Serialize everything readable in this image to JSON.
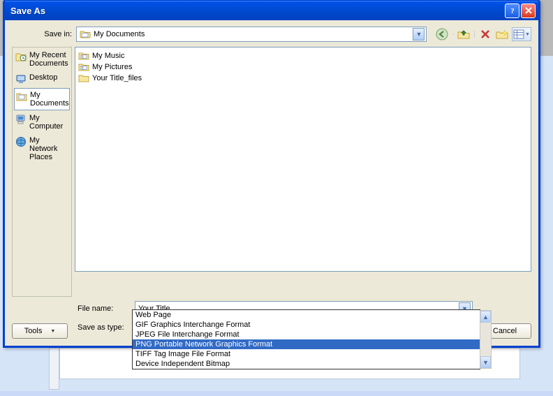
{
  "dialog": {
    "title": "Save As",
    "savein_label": "Save in:",
    "savein_value": "My Documents",
    "filename_label": "File name:",
    "filename_value": "Your Title",
    "savetype_label": "Save as type:",
    "savetype_value": "PNG Portable Network Graphics Format",
    "tools_label": "Tools",
    "cancel_label": "Cancel"
  },
  "places": [
    {
      "label": "My Recent Documents",
      "icon": "recent"
    },
    {
      "label": "Desktop",
      "icon": "desktop"
    },
    {
      "label": "My Documents",
      "icon": "mydocs",
      "selected": true
    },
    {
      "label": "My Computer",
      "icon": "mycomputer"
    },
    {
      "label": "My Network Places",
      "icon": "network"
    }
  ],
  "files": [
    {
      "label": "My Music",
      "icon": "folder-special"
    },
    {
      "label": "My Pictures",
      "icon": "folder-special"
    },
    {
      "label": "Your Title_files",
      "icon": "folder"
    }
  ],
  "savetype_options": [
    {
      "label": "Web Page"
    },
    {
      "label": "GIF Graphics Interchange Format"
    },
    {
      "label": "JPEG File Interchange Format"
    },
    {
      "label": "PNG Portable Network Graphics Format",
      "selected": true
    },
    {
      "label": "TIFF Tag Image File Format"
    },
    {
      "label": "Device Independent Bitmap"
    }
  ]
}
